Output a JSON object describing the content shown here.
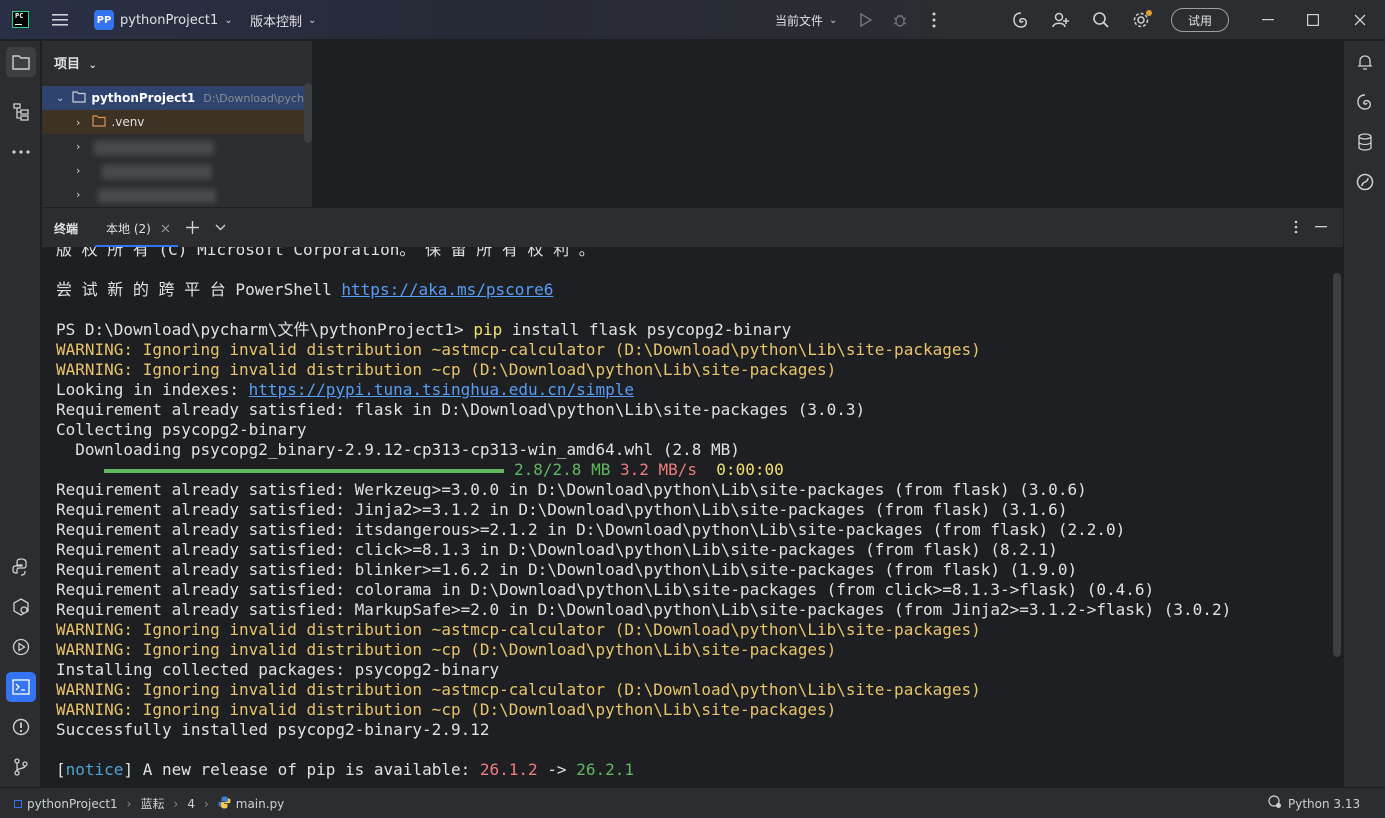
{
  "titlebar": {
    "project_badge": "PP",
    "project_name": "pythonProject1",
    "vcs_label": "版本控制",
    "run_config": "当前文件",
    "trial_label": "试用"
  },
  "project_panel": {
    "header": "项目",
    "root_name": "pythonProject1",
    "root_path": "D:\\Download\\pycharm",
    "venv_name": ".venv"
  },
  "terminal_tabs": {
    "title": "终端",
    "active_tab": "本地 (2)"
  },
  "terminal": {
    "lines": [
      {
        "text": "版 权 所 有 (C) Microsoft Corporation。 保 留 所 有 权 利 。",
        "type": "plain"
      },
      {
        "text": "",
        "type": "plain"
      },
      {
        "prefix": "尝 试 新 的 跨 平 台 PowerShell ",
        "link": "https://aka.ms/pscore6",
        "type": "link"
      },
      {
        "text": "",
        "type": "plain"
      },
      {
        "prefix": "PS D:\\Download\\pycharm\\文件\\pythonProject1> ",
        "cmd": "pip",
        "rest": " install flask psycopg2-binary",
        "type": "command"
      },
      {
        "text": "WARNING: Ignoring invalid distribution ~astmcp-calculator (D:\\Download\\python\\Lib\\site-packages)",
        "type": "warn"
      },
      {
        "text": "WARNING: Ignoring invalid distribution ~cp (D:\\Download\\python\\Lib\\site-packages)",
        "type": "warn"
      },
      {
        "prefix": "Looking in indexes: ",
        "link": "https://pypi.tuna.tsinghua.edu.cn/simple",
        "type": "link"
      },
      {
        "text": "Requirement already satisfied: flask in D:\\Download\\python\\Lib\\site-packages (3.0.3)",
        "type": "plain"
      },
      {
        "text": "Collecting psycopg2-binary",
        "type": "plain"
      },
      {
        "text": "  Downloading psycopg2_binary-2.9.12-cp313-cp313-win_amd64.whl (2.8 MB)",
        "type": "plain"
      },
      {
        "size": "2.8/2.8 MB",
        "speed": "3.2 MB/s",
        "eta": "0:00:00",
        "progress": 1.0,
        "type": "progress"
      },
      {
        "text": "Requirement already satisfied: Werkzeug>=3.0.0 in D:\\Download\\python\\Lib\\site-packages (from flask) (3.0.6)",
        "type": "plain"
      },
      {
        "text": "Requirement already satisfied: Jinja2>=3.1.2 in D:\\Download\\python\\Lib\\site-packages (from flask) (3.1.6)",
        "type": "plain"
      },
      {
        "text": "Requirement already satisfied: itsdangerous>=2.1.2 in D:\\Download\\python\\Lib\\site-packages (from flask) (2.2.0)",
        "type": "plain"
      },
      {
        "text": "Requirement already satisfied: click>=8.1.3 in D:\\Download\\python\\Lib\\site-packages (from flask) (8.2.1)",
        "type": "plain"
      },
      {
        "text": "Requirement already satisfied: blinker>=1.6.2 in D:\\Download\\python\\Lib\\site-packages (from flask) (1.9.0)",
        "type": "plain"
      },
      {
        "text": "Requirement already satisfied: colorama in D:\\Download\\python\\Lib\\site-packages (from click>=8.1.3->flask) (0.4.6)",
        "type": "plain"
      },
      {
        "text": "Requirement already satisfied: MarkupSafe>=2.0 in D:\\Download\\python\\Lib\\site-packages (from Jinja2>=3.1.2->flask) (3.0.2)",
        "type": "plain"
      },
      {
        "text": "WARNING: Ignoring invalid distribution ~astmcp-calculator (D:\\Download\\python\\Lib\\site-packages)",
        "type": "warn"
      },
      {
        "text": "WARNING: Ignoring invalid distribution ~cp (D:\\Download\\python\\Lib\\site-packages)",
        "type": "warn"
      },
      {
        "text": "Installing collected packages: psycopg2-binary",
        "type": "plain"
      },
      {
        "text": "WARNING: Ignoring invalid distribution ~astmcp-calculator (D:\\Download\\python\\Lib\\site-packages)",
        "type": "warn"
      },
      {
        "text": "WARNING: Ignoring invalid distribution ~cp (D:\\Download\\python\\Lib\\site-packages)",
        "type": "warn"
      },
      {
        "text": "Successfully installed psycopg2-binary-2.9.12",
        "type": "plain"
      },
      {
        "text": "",
        "type": "plain"
      },
      {
        "tag": "notice",
        "msg": " A new release of pip is available: ",
        "old": "26.1.2",
        "arrow": " -> ",
        "new": "26.2.1",
        "type": "notice"
      }
    ]
  },
  "statusbar": {
    "crumb_project": "pythonProject1",
    "crumb_2": "蓝耘",
    "crumb_3": "4",
    "crumb_file": "main.py",
    "interpreter": "Python 3.13"
  },
  "colors": {
    "accent": "#3574f0",
    "warning": "#e8c46a",
    "link": "#589df6",
    "progress": "#5fb85f"
  }
}
